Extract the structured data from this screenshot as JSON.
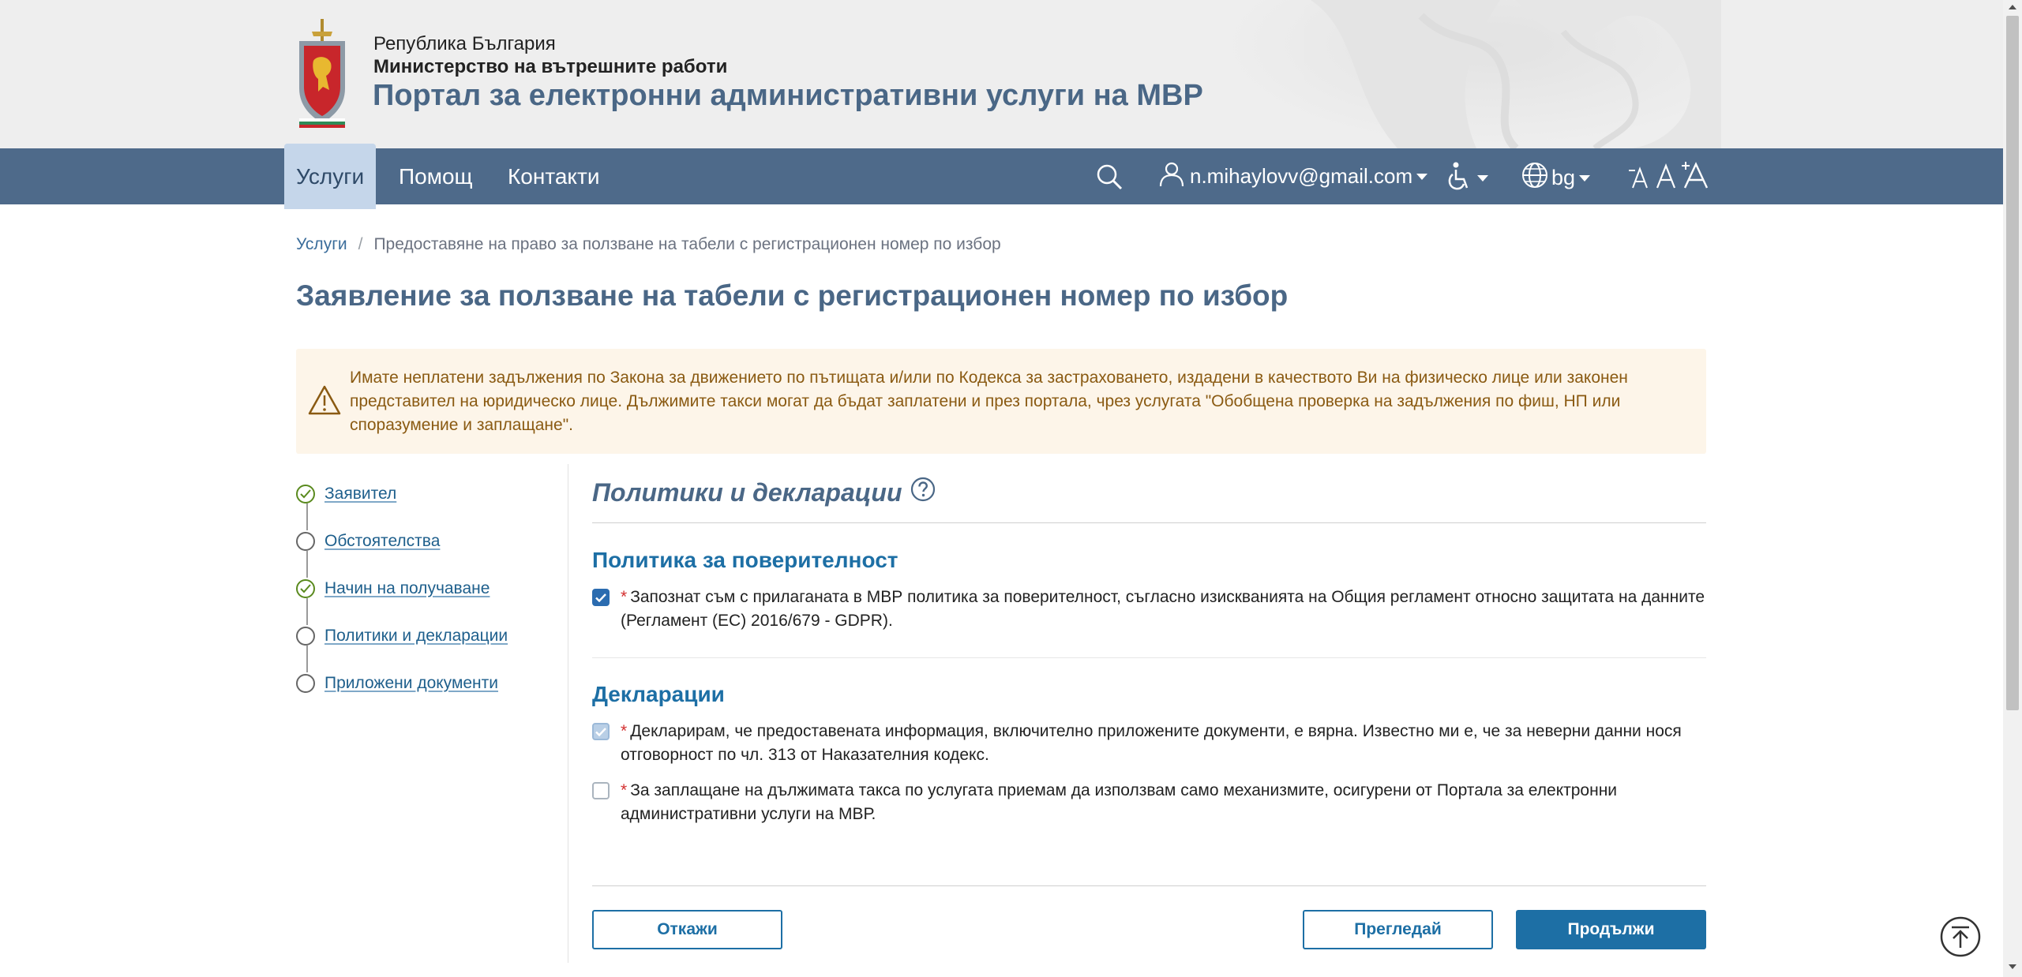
{
  "header": {
    "republic": "Република България",
    "ministry": "Министерство на вътрешните работи",
    "portal_title": "Портал за електронни административни услуги на МВР"
  },
  "nav": {
    "items": [
      {
        "label": "Услуги",
        "active": true
      },
      {
        "label": "Помощ",
        "active": false
      },
      {
        "label": "Контакти",
        "active": false
      }
    ],
    "user_email": "n.mihaylovv@gmail.com",
    "language": "bg"
  },
  "breadcrumb": {
    "root": "Услуги",
    "separator": "/",
    "current": "Предоставяне на право за ползване на табели с регистрационен номер по избор"
  },
  "page_title": "Заявление за ползване на табели с регистрационен номер по избор",
  "alert": {
    "text": "Имате неплатени задължения по Закона за движението по пътищата и/или по Кодекса за застраховането, издадени в качеството Ви на физическо лице или законен представител на юридическо лице. Дължимите такси могат да бъдат заплатени и през портала, чрез услугата \"Обобщена проверка на задължения по фиш, НП или споразумение и заплащане\"."
  },
  "steps": [
    {
      "label": "Заявител",
      "done": true
    },
    {
      "label": "Обстоятелства",
      "done": false
    },
    {
      "label": "Начин на получаване",
      "done": true
    },
    {
      "label": "Политики и декларации",
      "done": false
    },
    {
      "label": "Приложени документи",
      "done": false
    }
  ],
  "main": {
    "section_title": "Политики и декларации",
    "privacy": {
      "title": "Политика за поверителност",
      "required_mark": "*",
      "text": "Запознат съм с прилаганата в МВР политика за поверителност, съгласно изискванията на Общия регламент относно защитата на данните (Регламент (ЕС) 2016/679 - GDPR).",
      "checked": true
    },
    "declarations": {
      "title": "Декларации",
      "items": [
        {
          "required_mark": "*",
          "text": "Декларирам, че предоставената информация, включително приложените документи, е вярна. Известно ми е, че за неверни данни нося отговорност по чл. 313 от Наказателния кодекс.",
          "checked": true
        },
        {
          "required_mark": "*",
          "text": "За заплащане на дължимата такса по услугата приемам да използвам само механизмите, осигурени от Портала за електронни административни услуги на МВР.",
          "checked": false
        }
      ]
    }
  },
  "buttons": {
    "cancel": "Откажи",
    "review": "Прегледай",
    "continue": "Продължи"
  },
  "colors": {
    "nav_bg": "#4e6a8a",
    "title_blue": "#4a6786",
    "accent_blue": "#1d6fa5",
    "alert_bg": "#fdf5e9",
    "alert_text": "#8a5a12",
    "step_done": "#5a8a1e"
  }
}
